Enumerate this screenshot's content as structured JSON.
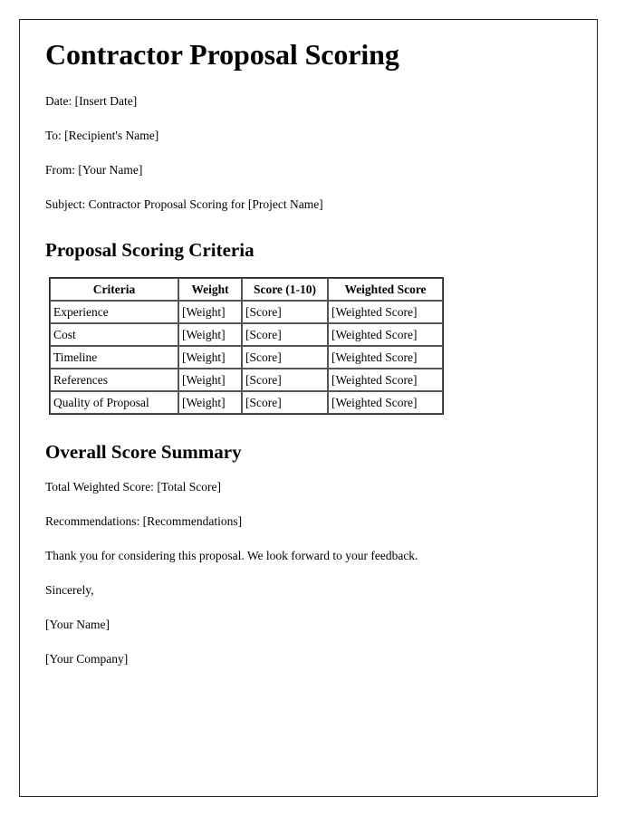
{
  "document": {
    "title": "Contractor Proposal Scoring",
    "meta_lines": [
      "Date: [Insert Date]",
      "To: [Recipient's Name]",
      "From: [Your Name]",
      "Subject: Contractor Proposal Scoring for [Project Name]"
    ],
    "criteria_section": {
      "heading": "Proposal Scoring Criteria",
      "table": {
        "columns": [
          "Criteria",
          "Weight",
          "Score (1-10)",
          "Weighted Score"
        ],
        "rows": [
          [
            "Experience",
            "[Weight]",
            "[Score]",
            "[Weighted Score]"
          ],
          [
            "Cost",
            "[Weight]",
            "[Score]",
            "[Weighted Score]"
          ],
          [
            "Timeline",
            "[Weight]",
            "[Score]",
            "[Weighted Score]"
          ],
          [
            "References",
            "[Weight]",
            "[Score]",
            "[Weighted Score]"
          ],
          [
            "Quality of Proposal",
            "[Weight]",
            "[Score]",
            "[Weighted Score]"
          ]
        ]
      }
    },
    "summary_section": {
      "heading": "Overall Score Summary",
      "lines": [
        "Total Weighted Score: [Total Score]",
        "Recommendations: [Recommendations]",
        "Thank you for considering this proposal. We look forward to your feedback.",
        "Sincerely,",
        "[Your Name]",
        "[Your Company]"
      ]
    }
  },
  "colors": {
    "text": "#000000",
    "page_border": "#222222",
    "table_border": "#555555",
    "background": "#ffffff"
  }
}
